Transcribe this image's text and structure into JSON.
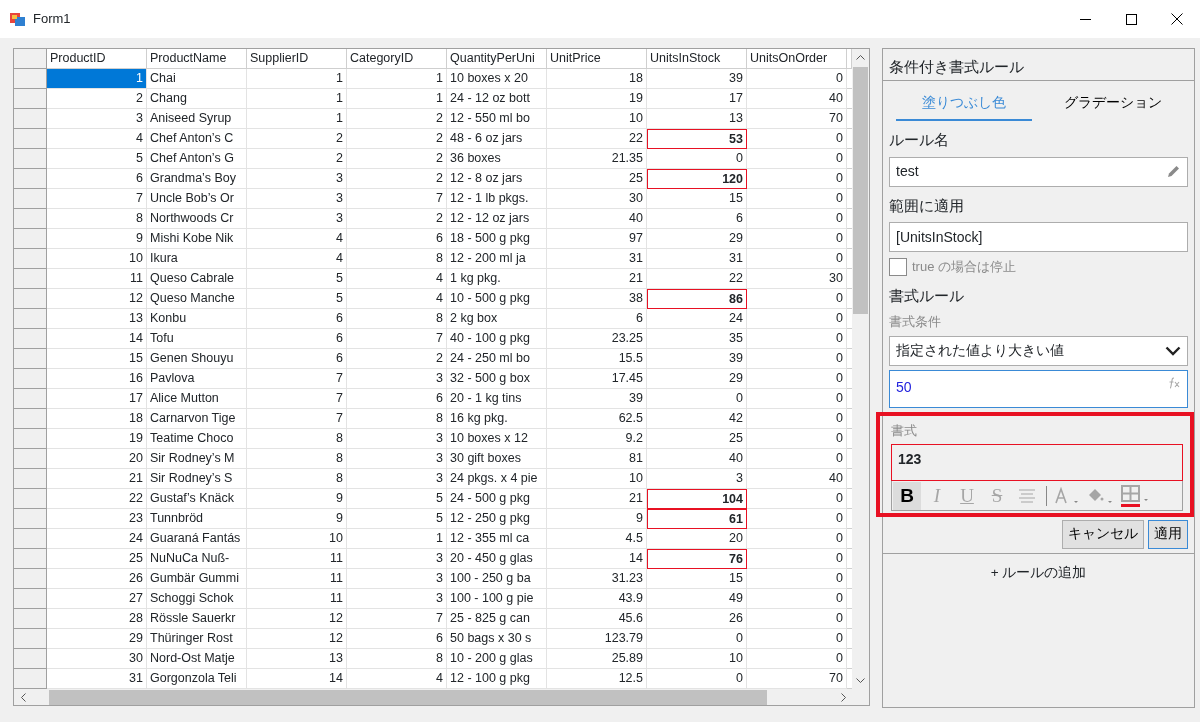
{
  "window": {
    "title": "Form1"
  },
  "grid": {
    "columns": [
      "ProductID",
      "ProductName",
      "SupplierID",
      "CategoryID",
      "QuantityPerUni",
      "UnitPrice",
      "UnitsInStock",
      "UnitsOnOrder"
    ],
    "rows": [
      {
        "cells": [
          "1",
          "Chai",
          "1",
          "1",
          "10 boxes x 20",
          "18",
          "39",
          "0"
        ],
        "selected": true,
        "highlighted": false
      },
      {
        "cells": [
          "2",
          "Chang",
          "1",
          "1",
          "24 - 12 oz bott",
          "19",
          "17",
          "40"
        ],
        "selected": false,
        "highlighted": false
      },
      {
        "cells": [
          "3",
          "Aniseed Syrup",
          "1",
          "2",
          "12 - 550 ml bo",
          "10",
          "13",
          "70"
        ],
        "selected": false,
        "highlighted": false
      },
      {
        "cells": [
          "4",
          "Chef Anton’s C",
          "2",
          "2",
          "48 - 6 oz jars",
          "22",
          "53",
          "0"
        ],
        "selected": false,
        "highlighted": true
      },
      {
        "cells": [
          "5",
          "Chef Anton’s G",
          "2",
          "2",
          "36 boxes",
          "21.35",
          "0",
          "0"
        ],
        "selected": false,
        "highlighted": false
      },
      {
        "cells": [
          "6",
          "Grandma’s Boy",
          "3",
          "2",
          "12 - 8 oz jars",
          "25",
          "120",
          "0"
        ],
        "selected": false,
        "highlighted": true
      },
      {
        "cells": [
          "7",
          "Uncle Bob’s Or",
          "3",
          "7",
          "12 - 1 lb pkgs.",
          "30",
          "15",
          "0"
        ],
        "selected": false,
        "highlighted": false
      },
      {
        "cells": [
          "8",
          "Northwoods Cr",
          "3",
          "2",
          "12 - 12 oz jars",
          "40",
          "6",
          "0"
        ],
        "selected": false,
        "highlighted": false
      },
      {
        "cells": [
          "9",
          "Mishi Kobe Nik",
          "4",
          "6",
          "18 - 500 g pkg",
          "97",
          "29",
          "0"
        ],
        "selected": false,
        "highlighted": false
      },
      {
        "cells": [
          "10",
          "Ikura",
          "4",
          "8",
          "12 - 200 ml ja",
          "31",
          "31",
          "0"
        ],
        "selected": false,
        "highlighted": false
      },
      {
        "cells": [
          "11",
          "Queso Cabrale",
          "5",
          "4",
          "1 kg pkg.",
          "21",
          "22",
          "30"
        ],
        "selected": false,
        "highlighted": false
      },
      {
        "cells": [
          "12",
          "Queso Manche",
          "5",
          "4",
          "10 - 500 g pkg",
          "38",
          "86",
          "0"
        ],
        "selected": false,
        "highlighted": true
      },
      {
        "cells": [
          "13",
          "Konbu",
          "6",
          "8",
          "2 kg box",
          "6",
          "24",
          "0"
        ],
        "selected": false,
        "highlighted": false
      },
      {
        "cells": [
          "14",
          "Tofu",
          "6",
          "7",
          "40 - 100 g pkg",
          "23.25",
          "35",
          "0"
        ],
        "selected": false,
        "highlighted": false
      },
      {
        "cells": [
          "15",
          "Genen Shouyu",
          "6",
          "2",
          "24 - 250 ml bo",
          "15.5",
          "39",
          "0"
        ],
        "selected": false,
        "highlighted": false
      },
      {
        "cells": [
          "16",
          "Pavlova",
          "7",
          "3",
          "32 - 500 g box",
          "17.45",
          "29",
          "0"
        ],
        "selected": false,
        "highlighted": false
      },
      {
        "cells": [
          "17",
          "Alice Mutton",
          "7",
          "6",
          "20 - 1 kg tins",
          "39",
          "0",
          "0"
        ],
        "selected": false,
        "highlighted": false
      },
      {
        "cells": [
          "18",
          "Carnarvon Tige",
          "7",
          "8",
          "16 kg pkg.",
          "62.5",
          "42",
          "0"
        ],
        "selected": false,
        "highlighted": false
      },
      {
        "cells": [
          "19",
          "Teatime Choco",
          "8",
          "3",
          "10 boxes x 12",
          "9.2",
          "25",
          "0"
        ],
        "selected": false,
        "highlighted": false
      },
      {
        "cells": [
          "20",
          "Sir Rodney’s M",
          "8",
          "3",
          "30 gift boxes",
          "81",
          "40",
          "0"
        ],
        "selected": false,
        "highlighted": false
      },
      {
        "cells": [
          "21",
          "Sir Rodney’s S",
          "8",
          "3",
          "24 pkgs. x 4 pie",
          "10",
          "3",
          "40"
        ],
        "selected": false,
        "highlighted": false
      },
      {
        "cells": [
          "22",
          "Gustaf’s Knäck",
          "9",
          "5",
          "24 - 500 g pkg",
          "21",
          "104",
          "0"
        ],
        "selected": false,
        "highlighted": true
      },
      {
        "cells": [
          "23",
          "Tunnbröd",
          "9",
          "5",
          "12 - 250 g pkg",
          "9",
          "61",
          "0"
        ],
        "selected": false,
        "highlighted": true
      },
      {
        "cells": [
          "24",
          "Guaraná Fantás",
          "10",
          "1",
          "12 - 355 ml ca",
          "4.5",
          "20",
          "0"
        ],
        "selected": false,
        "highlighted": false
      },
      {
        "cells": [
          "25",
          "NuNuCa Nuß-",
          "11",
          "3",
          "20 - 450 g glas",
          "14",
          "76",
          "0"
        ],
        "selected": false,
        "highlighted": true
      },
      {
        "cells": [
          "26",
          "Gumbär Gummi",
          "11",
          "3",
          "100 - 250 g ba",
          "31.23",
          "15",
          "0"
        ],
        "selected": false,
        "highlighted": false
      },
      {
        "cells": [
          "27",
          "Schoggi Schok",
          "11",
          "3",
          "100 - 100 g pie",
          "43.9",
          "49",
          "0"
        ],
        "selected": false,
        "highlighted": false
      },
      {
        "cells": [
          "28",
          "Rössle Sauerkr",
          "12",
          "7",
          "25 - 825 g can",
          "45.6",
          "26",
          "0"
        ],
        "selected": false,
        "highlighted": false
      },
      {
        "cells": [
          "29",
          "Thüringer Rost",
          "12",
          "6",
          "50 bags x 30 s",
          "123.79",
          "0",
          "0"
        ],
        "selected": false,
        "highlighted": false
      },
      {
        "cells": [
          "30",
          "Nord-Ost Matje",
          "13",
          "8",
          "10 - 200 g glas",
          "25.89",
          "10",
          "0"
        ],
        "selected": false,
        "highlighted": false
      },
      {
        "cells": [
          "31",
          "Gorgonzola Teli",
          "14",
          "4",
          "12 - 100 g pkg",
          "12.5",
          "0",
          "70"
        ],
        "selected": false,
        "highlighted": false
      }
    ]
  },
  "panel": {
    "title": "条件付き書式ルール",
    "tabs": [
      {
        "label": "塗りつぶし色",
        "selected": true
      },
      {
        "label": "グラデーション",
        "selected": false
      }
    ],
    "rule_name": {
      "label": "ルール名",
      "value": "test"
    },
    "range": {
      "label": "範囲に適用",
      "value": "[UnitsInStock]"
    },
    "stop_if_true": {
      "label": "true の場合は停止",
      "checked": false
    },
    "format_rule": {
      "heading": "書式ルール",
      "condition_label": "書式条件",
      "condition": "指定された値より大きい値",
      "value": "50"
    },
    "format": {
      "label": "書式",
      "preview": "123",
      "toolbar": [
        {
          "kind": "bold",
          "label": "B",
          "active": true
        },
        {
          "kind": "italic",
          "label": "I",
          "active": false
        },
        {
          "kind": "underline",
          "label": "U",
          "active": false
        },
        {
          "kind": "strike",
          "label": "S",
          "active": false
        },
        {
          "kind": "align",
          "active": false
        },
        {
          "kind": "separator"
        },
        {
          "kind": "font-color",
          "active": false
        },
        {
          "kind": "fill-color",
          "active": false
        },
        {
          "kind": "borders",
          "active": false
        }
      ]
    },
    "buttons": [
      {
        "label": "キャンセル",
        "primary": false
      },
      {
        "label": "適用",
        "primary": true
      }
    ],
    "add_rule": "+ ルールの追加"
  }
}
